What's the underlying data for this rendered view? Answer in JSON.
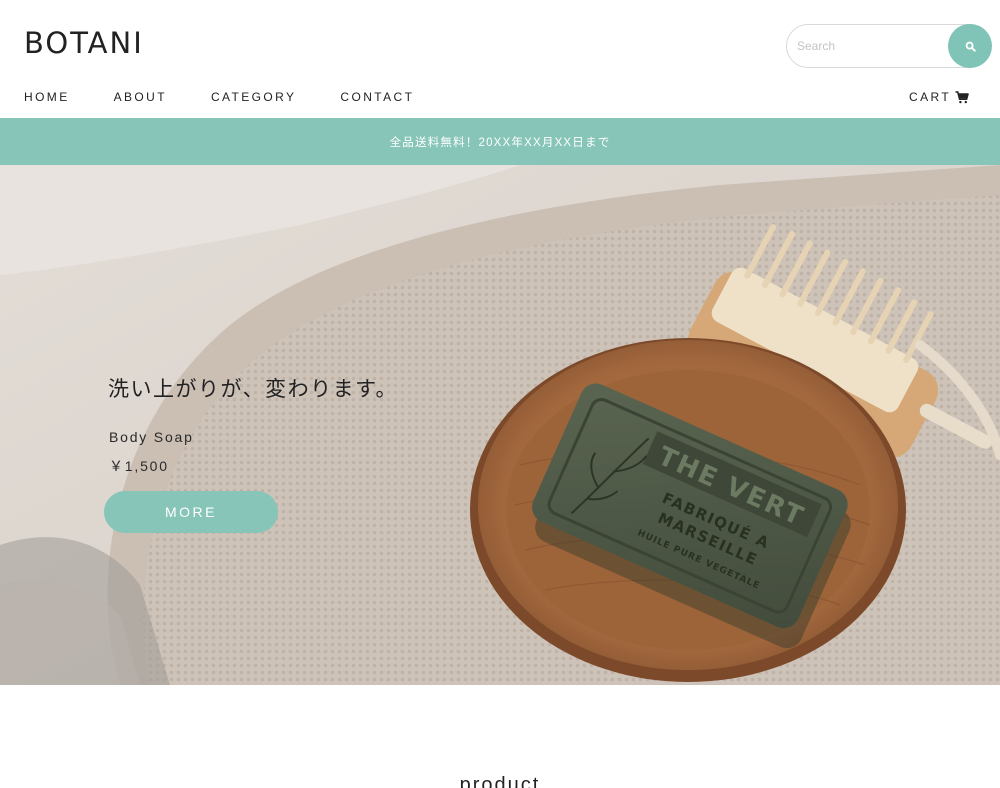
{
  "header": {
    "logo": "BOTANI",
    "search": {
      "placeholder": "Search",
      "icon": "search-icon"
    },
    "nav": [
      {
        "label": "HOME"
      },
      {
        "label": "ABOUT"
      },
      {
        "label": "CATEGORY"
      },
      {
        "label": "CONTACT"
      }
    ],
    "cart": {
      "label": "CART",
      "icon": "cart-icon"
    }
  },
  "banner": {
    "text": "全品送料無料！20XX年XX月XX日まで"
  },
  "hero": {
    "catchcopy": "洗い上がりが、変わります。",
    "product_name": "Body Soap",
    "price": "￥1,500",
    "button_label": "MORE",
    "soap_lines": [
      "THE VERT",
      "FABRIQUÉ A",
      "MARSEILLE",
      "HUILE PURE VEGETALE"
    ]
  },
  "section": {
    "title": "product"
  },
  "colors": {
    "accent": "#86c5b8",
    "search_button": "#7fc4b6",
    "text": "#222222"
  }
}
